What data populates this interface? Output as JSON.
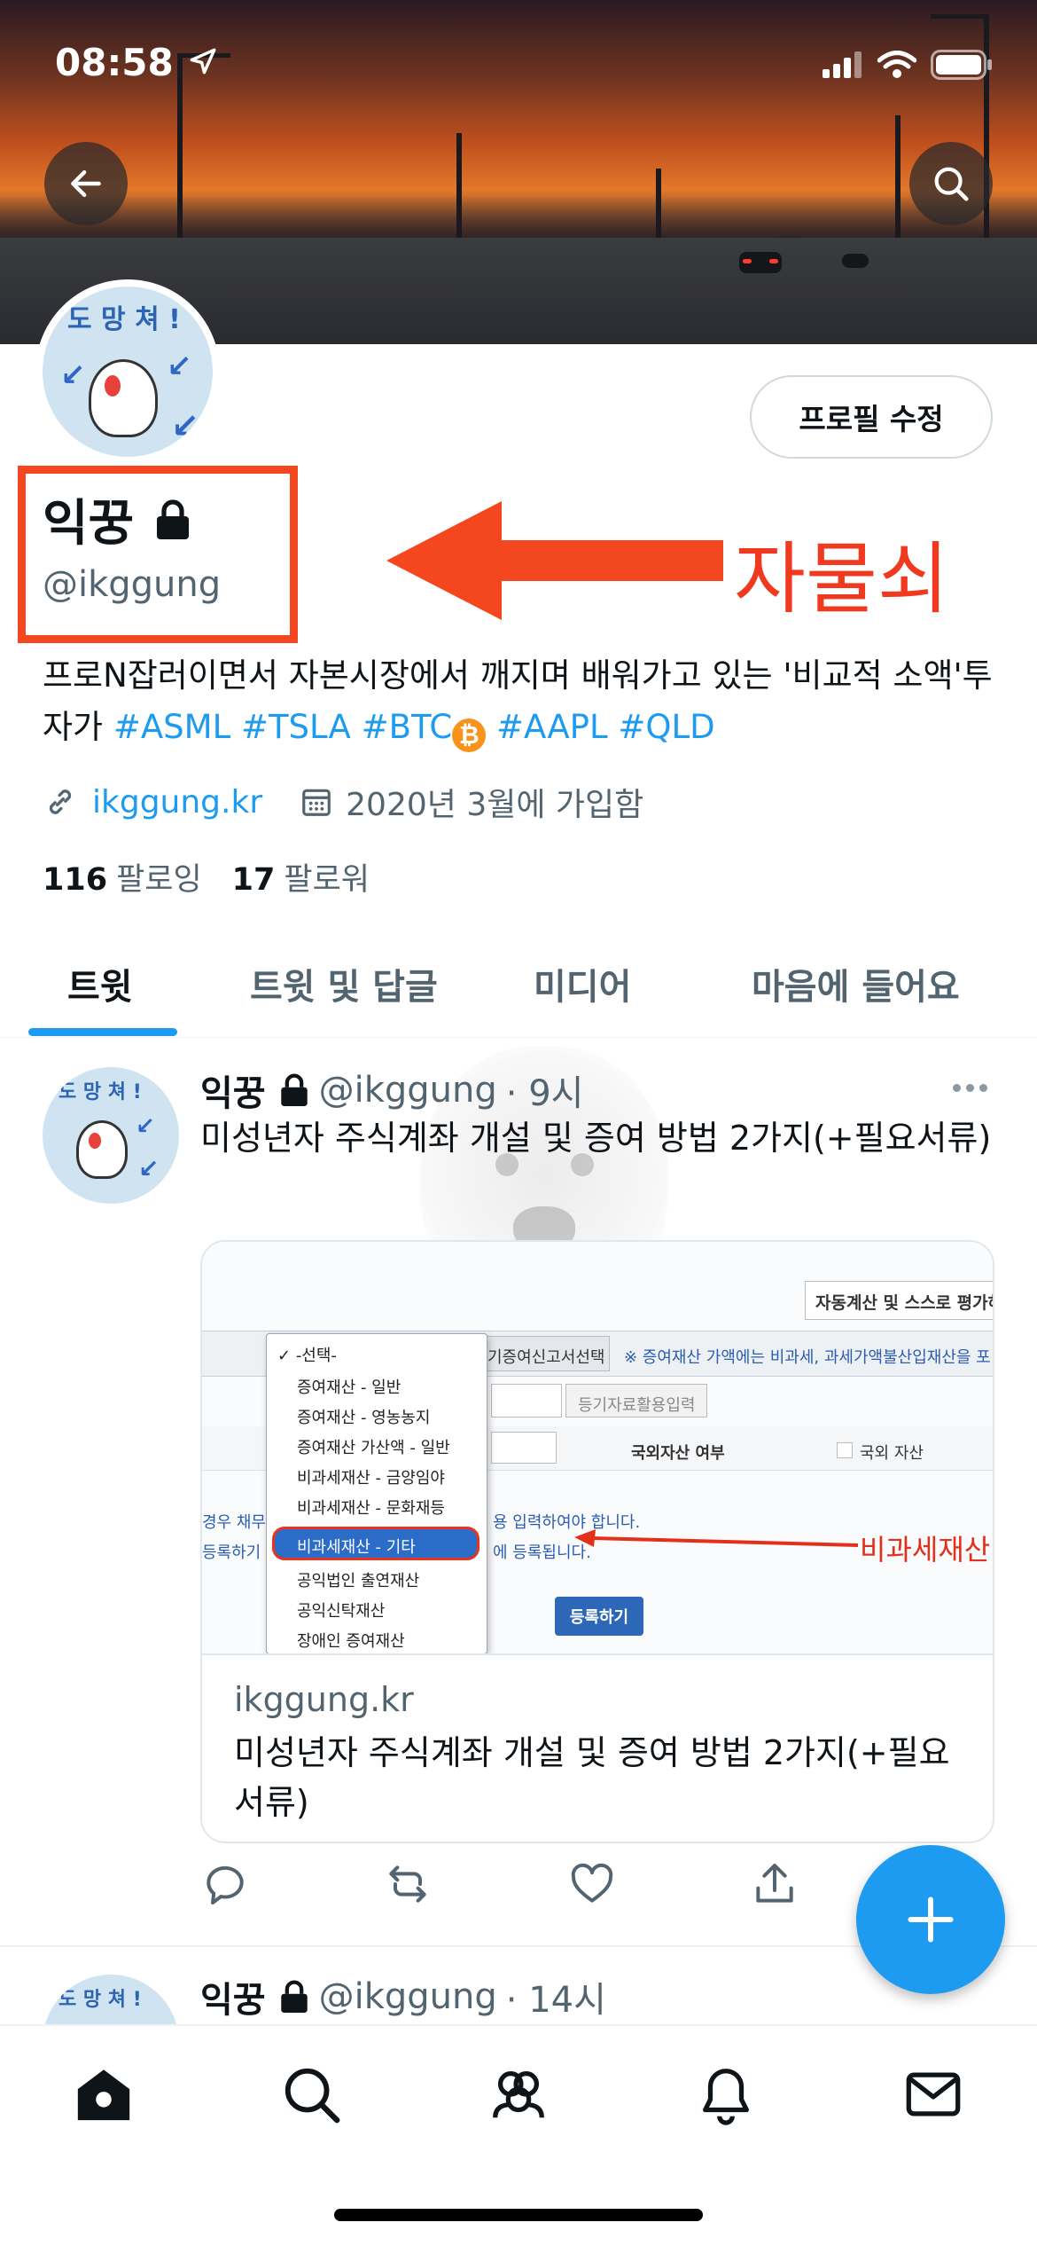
{
  "status_bar": {
    "time": "08:58"
  },
  "profile": {
    "name": "익꿍",
    "handle": "@ikggung",
    "edit_button": "프로필 수정",
    "annotation": "자물쇠",
    "avatar_text": "도 망 쳐 !",
    "bio_text": "프로N잡러이면서 자본시장에서 깨지며 배워가고 있는 '비교적 소액'투자가 ",
    "bio_tags": [
      "#ASML",
      "#TSLA",
      "#BTC",
      "#AAPL",
      "#QLD"
    ],
    "website": "ikggung.kr",
    "joined": "2020년 3월에 가입함",
    "following_count": "116",
    "following_label": "팔로잉",
    "followers_count": "17",
    "followers_label": "팔로워"
  },
  "tabs": [
    "트윗",
    "트윗 및 답글",
    "미디어",
    "마음에 들어요"
  ],
  "tweets": [
    {
      "name": "익꿍",
      "handle": "@ikggung",
      "time": "· 9시",
      "text": "미성년자 주식계좌 개설 및 증여 방법 2가지(+필요서류)",
      "card": {
        "domain": "ikggung.kr",
        "title": "미성년자 주식계좌 개설 및 증여 방법 2가지(+필요서류)",
        "image": {
          "top_button": "자동계산 및 스스로 평가하",
          "tab": "기증여신고서선택",
          "notice": "※ 증여재산 가액에는 비과세, 과세가액불산입재산을 포",
          "reg_input": "등기자료활용입력",
          "foreign_label": "국외자산 여부",
          "foreign_check": "국외 자산",
          "line1": "경우 채무",
          "line1b": "용 입력하여야 합니다.",
          "line2": "등록하기",
          "line2b": "에 등록됩니다.",
          "dropdown_items": [
            "-선택-",
            "증여재산 - 일반",
            "증여재산 - 영농농지",
            "증여재산 가산액 - 일반",
            "비과세재산 - 금양임야",
            "비과세재산 - 문화재등",
            "비과세재산 - 기타",
            "공익법인 출연재산",
            "공익신탁재산",
            "장애인 증여재산"
          ],
          "register_button": "등록하기",
          "red_note": "비과세재산"
        }
      }
    },
    {
      "name": "익꿍",
      "handle": "@ikggung",
      "time": "· 14시"
    }
  ],
  "colors": {
    "accent": "#1d9bf0",
    "annotation": "#f4461f"
  }
}
